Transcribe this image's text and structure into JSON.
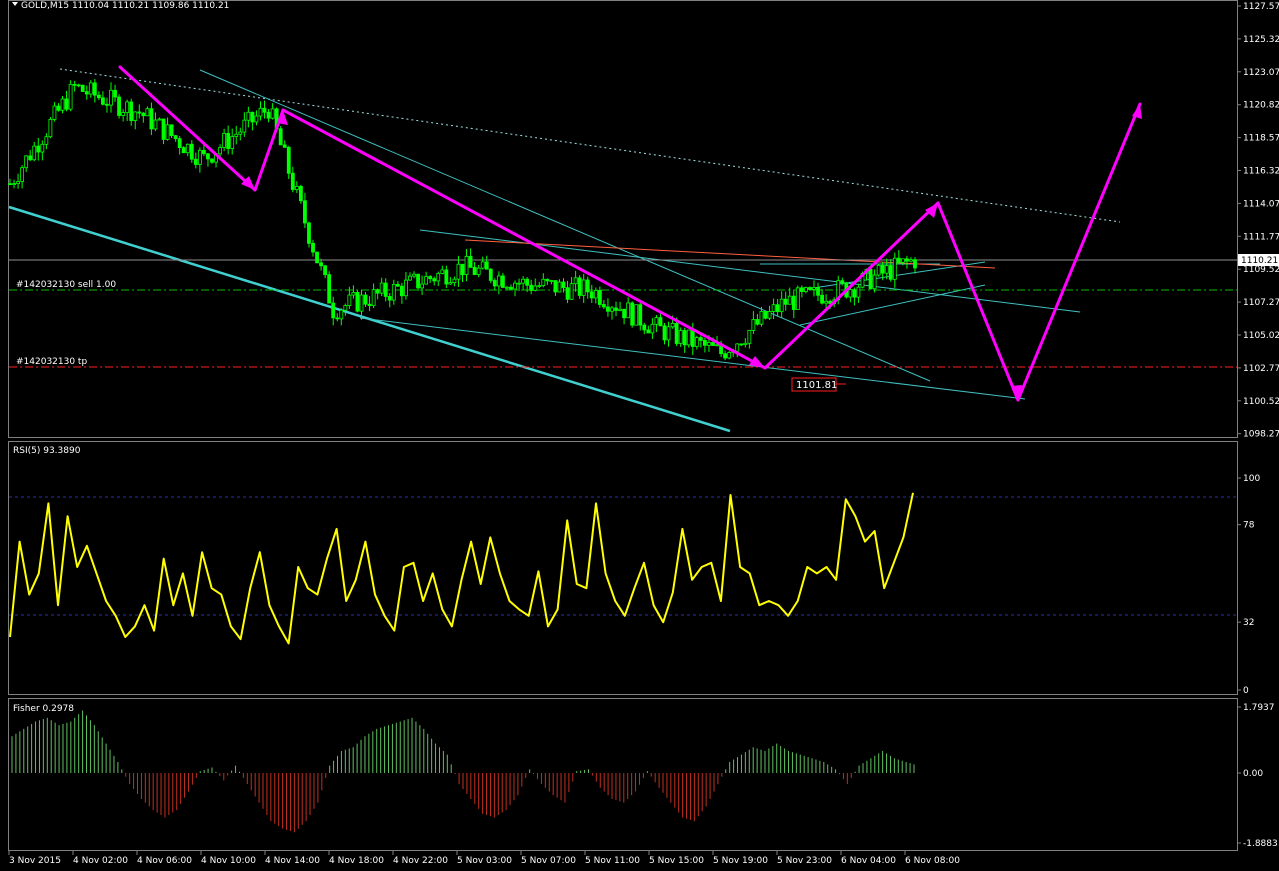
{
  "price_panel": {
    "symbol_header": "GOLD,M15  1110.04 1110.21 1109.86 1110.21",
    "current_price_tag": "1110.21",
    "y_ticks": [
      "1127.57",
      "1125.32",
      "1123.07",
      "1120.82",
      "1118.57",
      "1116.32",
      "1114.07",
      "1111.77",
      "1109.52",
      "1107.27",
      "1105.02",
      "1102.77",
      "1100.52",
      "1098.27"
    ],
    "order_sell_label": "#142032130 sell 1.00",
    "order_tp_label": "#142032130 tp",
    "stop_price_label": "1101.81",
    "colors": {
      "bull": "#00ff00",
      "bear": "#00ff00",
      "arrows": "#ff00ff",
      "channel": "#40d0d0",
      "sell_line": "#00c000",
      "tp_line": "#ff2020",
      "resistance": "#ff6040"
    }
  },
  "rsi_panel": {
    "label": "RSI(5) 93.3890",
    "y_ticks": [
      "100",
      "78",
      "32",
      "0"
    ],
    "levels": [
      78,
      32
    ],
    "color": "#ffff00"
  },
  "fisher_panel": {
    "label": "Fisher 0.2978",
    "y_ticks": [
      "1.7937",
      "0.00",
      "-1.8883"
    ],
    "pos_color": "#60c060",
    "neg_color": "#c03020"
  },
  "x_axis": {
    "labels": [
      "3 Nov 2015",
      "4 Nov 02:00",
      "4 Nov 06:00",
      "4 Nov 10:00",
      "4 Nov 14:00",
      "4 Nov 18:00",
      "4 Nov 22:00",
      "5 Nov 03:00",
      "5 Nov 07:00",
      "5 Nov 11:00",
      "5 Nov 15:00",
      "5 Nov 19:00",
      "5 Nov 23:00",
      "6 Nov 04:00",
      "6 Nov 08:00"
    ]
  },
  "chart_data": [
    {
      "type": "candlestick",
      "title": "GOLD,M15",
      "ylim": [
        1098.0,
        1128.0
      ],
      "x": [
        "3 Nov 2015",
        "4 Nov 02:00",
        "4 Nov 06:00",
        "4 Nov 10:00",
        "4 Nov 14:00",
        "4 Nov 18:00",
        "4 Nov 22:00",
        "5 Nov 03:00",
        "5 Nov 07:00",
        "5 Nov 11:00",
        "5 Nov 15:00",
        "5 Nov 19:00",
        "5 Nov 23:00",
        "6 Nov 04:00",
        "6 Nov 08:00"
      ],
      "close_path": [
        1115.4,
        1122.0,
        1120.3,
        1117.1,
        1120.6,
        1106.8,
        1108.2,
        1109.7,
        1108.5,
        1108.1,
        1105.5,
        1103.8,
        1107.3,
        1108.3,
        1110.2
      ],
      "last": {
        "open": 1110.04,
        "high": 1110.21,
        "low": 1109.86,
        "close": 1110.21
      }
    },
    {
      "type": "line",
      "title": "RSI(5)",
      "ylim": [
        0,
        100
      ],
      "levels": [
        78,
        32
      ],
      "last": 93.389,
      "values": [
        25,
        70,
        45,
        55,
        88,
        40,
        82,
        58,
        68,
        55,
        42,
        35,
        25,
        30,
        40,
        28,
        62,
        40,
        55,
        35,
        65,
        48,
        45,
        30,
        24,
        48,
        65,
        40,
        30,
        22,
        58,
        48,
        45,
        62,
        76,
        42,
        52,
        70,
        45,
        35,
        28,
        58,
        60,
        42,
        55,
        38,
        30,
        52,
        70,
        50,
        72,
        55,
        42,
        38,
        35,
        56,
        30,
        38,
        80,
        50,
        48,
        88,
        55,
        42,
        35,
        48,
        60,
        40,
        32,
        46,
        76,
        52,
        58,
        60,
        42,
        92,
        58,
        55,
        40,
        42,
        40,
        35,
        42,
        58,
        55,
        58,
        52,
        90,
        82,
        70,
        75,
        48,
        60,
        72,
        93
      ]
    },
    {
      "type": "bar",
      "title": "Fisher",
      "ylim": [
        -1.8883,
        1.7937
      ],
      "last": 0.2978,
      "values": [
        1.0,
        1.2,
        1.4,
        1.5,
        1.3,
        1.4,
        1.7,
        1.3,
        0.8,
        0.3,
        -0.3,
        -0.7,
        -1.0,
        -1.2,
        -1.0,
        -0.5,
        0.05,
        0.15,
        -0.2,
        0.2,
        -0.3,
        -0.8,
        -1.3,
        -1.5,
        -1.6,
        -1.3,
        -0.8,
        0.2,
        0.6,
        0.7,
        1.0,
        1.2,
        1.3,
        1.4,
        1.5,
        1.2,
        0.8,
        0.5,
        -0.3,
        -0.7,
        -1.1,
        -1.2,
        -1.0,
        -0.6,
        0.1,
        -0.3,
        -0.6,
        -0.8,
        0.05,
        0.1,
        -0.4,
        -0.7,
        -0.8,
        -0.5,
        0.05,
        -0.4,
        -0.8,
        -1.2,
        -1.3,
        -0.9,
        -0.3,
        0.3,
        0.5,
        0.7,
        0.6,
        0.8,
        0.6,
        0.5,
        0.4,
        0.3,
        0.1,
        -0.3,
        0.2,
        0.4,
        0.6,
        0.4,
        0.3
      ]
    }
  ]
}
